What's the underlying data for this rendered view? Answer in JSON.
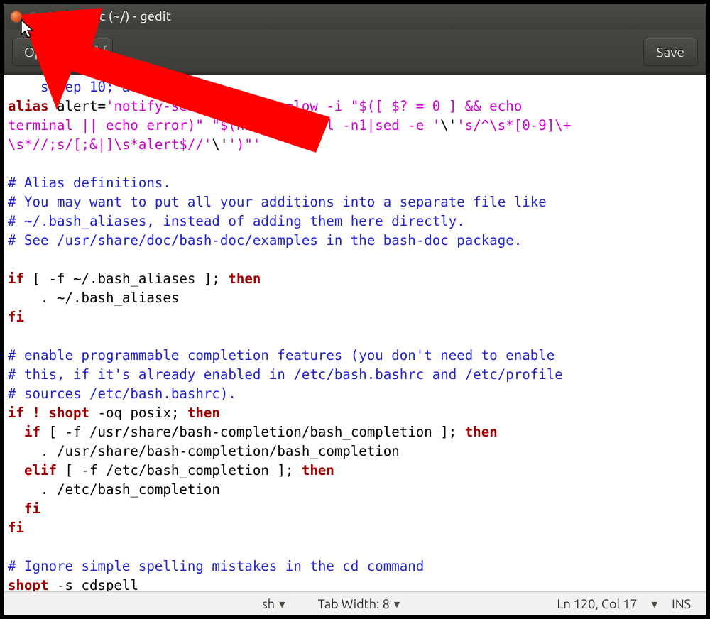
{
  "window": {
    "title": "bashrc (~/) - gedit"
  },
  "toolbar": {
    "open_label": "Open",
    "new_label": "]+[",
    "save_label": "Save"
  },
  "editor": {
    "tokens": [
      {
        "cls": "cmt",
        "t": "    sleep 10; alert"
      },
      {
        "t": "\n"
      },
      {
        "cls": "kw",
        "t": "alias"
      },
      {
        "t": " alert="
      },
      {
        "cls": "str",
        "t": "'notify-send --urgency=low -i \"$([ $? = 0 ] && echo \nterminal || echo error)\" \"$(history|tail -n1|sed -e '"
      },
      {
        "t": "\\'"
      },
      {
        "cls": "str",
        "t": "'s/^\\s*[0-9]\\+\n\\s*//;s/[;&|]\\s*alert$//'"
      },
      {
        "t": "\\'"
      },
      {
        "cls": "str",
        "t": "')\"'"
      },
      {
        "t": "\n\n"
      },
      {
        "cls": "cmt",
        "t": "# Alias definitions."
      },
      {
        "t": "\n"
      },
      {
        "cls": "cmt",
        "t": "# You may want to put all your additions into a separate file like"
      },
      {
        "t": "\n"
      },
      {
        "cls": "cmt",
        "t": "# ~/.bash_aliases, instead of adding them here directly."
      },
      {
        "t": "\n"
      },
      {
        "cls": "cmt",
        "t": "# See /usr/share/doc/bash-doc/examples in the bash-doc package."
      },
      {
        "t": "\n"
      },
      {
        "t": "\n"
      },
      {
        "cls": "kw",
        "t": "if"
      },
      {
        "t": " [ -f ~/.bash_aliases ]; "
      },
      {
        "cls": "kw",
        "t": "then"
      },
      {
        "t": "\n"
      },
      {
        "t": "    . ~/.bash_aliases\n"
      },
      {
        "cls": "kw",
        "t": "fi"
      },
      {
        "t": "\n"
      },
      {
        "t": "\n"
      },
      {
        "cls": "cmt",
        "t": "# enable programmable completion features (you don't need to enable"
      },
      {
        "t": "\n"
      },
      {
        "cls": "cmt",
        "t": "# this, if it's already enabled in /etc/bash.bashrc and /etc/profile"
      },
      {
        "t": "\n"
      },
      {
        "cls": "cmt",
        "t": "# sources /etc/bash.bashrc)."
      },
      {
        "t": "\n"
      },
      {
        "cls": "kw",
        "t": "if"
      },
      {
        "t": " "
      },
      {
        "cls": "bang",
        "t": "!"
      },
      {
        "t": " "
      },
      {
        "cls": "kw",
        "t": "shopt"
      },
      {
        "t": " -oq posix; "
      },
      {
        "cls": "kw",
        "t": "then"
      },
      {
        "t": "\n"
      },
      {
        "t": "  "
      },
      {
        "cls": "kw",
        "t": "if"
      },
      {
        "t": " [ -f /usr/share/bash-completion/bash_completion ]; "
      },
      {
        "cls": "kw",
        "t": "then"
      },
      {
        "t": "\n"
      },
      {
        "t": "    . /usr/share/bash-completion/bash_completion\n"
      },
      {
        "t": "  "
      },
      {
        "cls": "kw",
        "t": "elif"
      },
      {
        "t": " [ -f /etc/bash_completion ]; "
      },
      {
        "cls": "kw",
        "t": "then"
      },
      {
        "t": "\n"
      },
      {
        "t": "    . /etc/bash_completion\n"
      },
      {
        "t": "  "
      },
      {
        "cls": "kw",
        "t": "fi"
      },
      {
        "t": "\n"
      },
      {
        "cls": "kw",
        "t": "fi"
      },
      {
        "t": "\n"
      },
      {
        "t": "\n"
      },
      {
        "cls": "cmt",
        "t": "# Ignore simple spelling mistakes in the cd command"
      },
      {
        "t": "\n"
      },
      {
        "cls": "kw",
        "t": "shopt"
      },
      {
        "t": " -s cdspell\n"
      }
    ]
  },
  "statusbar": {
    "lang": "sh",
    "tab_label": "Tab Width: 8",
    "pos": "Ln 120, Col 17",
    "mode": "INS"
  }
}
